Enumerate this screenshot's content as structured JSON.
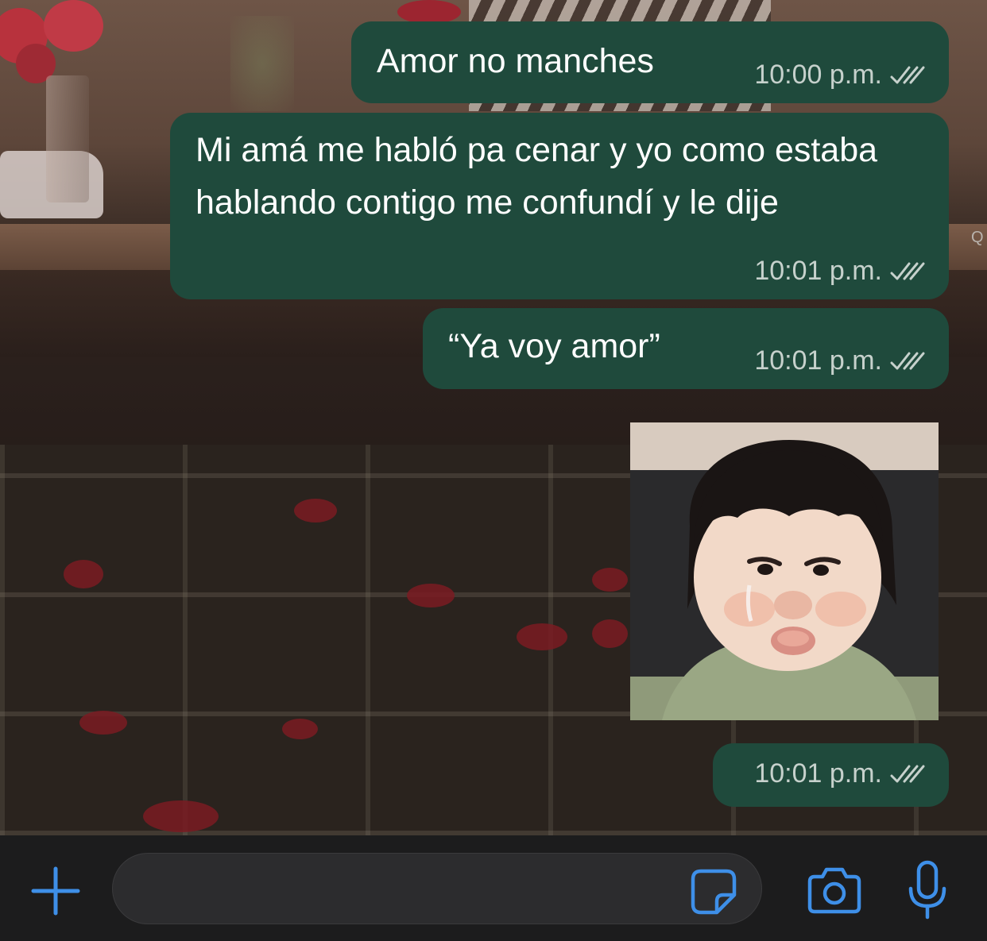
{
  "messages": [
    {
      "text": "Amor no manches",
      "time": "10:00 p.m.",
      "status": "read"
    },
    {
      "text": "Mi amá me habló pa cenar y yo como estaba hablando contigo me confundí y le dije",
      "time": "10:01 p.m.",
      "status": "read"
    },
    {
      "text": "“Ya voy amor”",
      "time": "10:01 p.m.",
      "status": "read"
    },
    {
      "type": "sticker",
      "sticker_icon": "crying-baby-sticker",
      "time": "10:01 p.m.",
      "status": "read"
    }
  ],
  "background": {
    "edge_letter": "Q"
  },
  "input_bar": {
    "placeholder": "",
    "icons": [
      "plus-icon",
      "sticker-icon",
      "camera-icon",
      "microphone-icon"
    ]
  },
  "colors": {
    "outgoing_bubble": "#1f4a3c",
    "accent": "#3e8fe8",
    "input_bar_bg": "#1c1c1d",
    "read_ticks": "#c6d1cc"
  }
}
